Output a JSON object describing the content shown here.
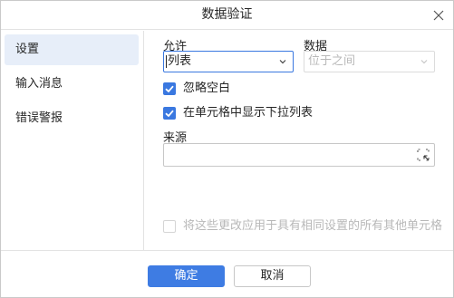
{
  "dialog": {
    "title": "数据验证"
  },
  "sidebar": {
    "items": [
      {
        "label": "设置"
      },
      {
        "label": "输入消息"
      },
      {
        "label": "错误警报"
      }
    ]
  },
  "settings": {
    "allow_label": "允许",
    "allow_value": "列表",
    "data_label": "数据",
    "data_value": "位于之间",
    "ignore_blank": {
      "label": "忽略空白",
      "checked": true
    },
    "in_cell_dropdown": {
      "label": "在单元格中显示下拉列表",
      "checked": true
    },
    "source_label": "来源",
    "source_value": "",
    "apply_all": {
      "label": "将这些更改应用于具有相同设置的所有其他单元格",
      "checked": false,
      "enabled": false
    }
  },
  "footer": {
    "ok_label": "确定",
    "cancel_label": "取消"
  },
  "colors": {
    "accent": "#3e7ce3",
    "sidebar_active": "#e7eef9",
    "disabled_text": "#b8b8b8"
  },
  "icons": {
    "close": "close-icon",
    "dropdown": "chevron-down-icon",
    "range_select": "range-select-icon",
    "check": "checkmark-icon"
  }
}
